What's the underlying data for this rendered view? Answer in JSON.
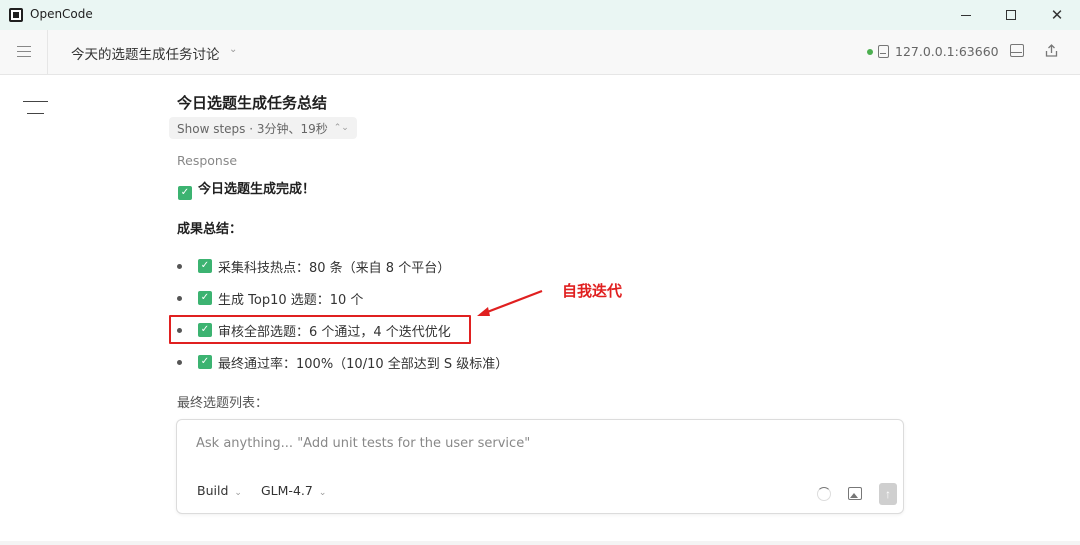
{
  "window": {
    "app_name": "OpenCode",
    "minimize_label": "",
    "maximize_label": "",
    "close_label": "✕"
  },
  "header": {
    "session_title": "今天的选题生成任务讨论",
    "session_chevron": "⌄",
    "server_address": "127.0.0.1:63660",
    "status_color": "#4caf50"
  },
  "main": {
    "task_title": "今日选题生成任务总结",
    "steps_label": "Show steps · 3分钟、19秒",
    "steps_chevron": "⌃⌄",
    "response_label": "Response",
    "done_line": "今日选题生成完成！",
    "summary_heading": "成果总结：",
    "bullets": [
      "采集科技热点：80 条（来自 8 个平台）",
      "生成 Top10 选题：10 个",
      "审核全部选题：6 个通过，4 个迭代优化",
      "最终通过率：100%（10/10 全部达到 S 级标准）"
    ],
    "final_list_label": "最终选题列表："
  },
  "annotation": {
    "text": "自我迭代",
    "color": "#e02020"
  },
  "composer": {
    "placeholder": "Ask anything... \"Add unit tests for the user service\"",
    "mode": "Build",
    "model": "GLM-4.7",
    "chevron": "⌄",
    "send_glyph": "↑"
  },
  "icons": {
    "check": "✓"
  }
}
